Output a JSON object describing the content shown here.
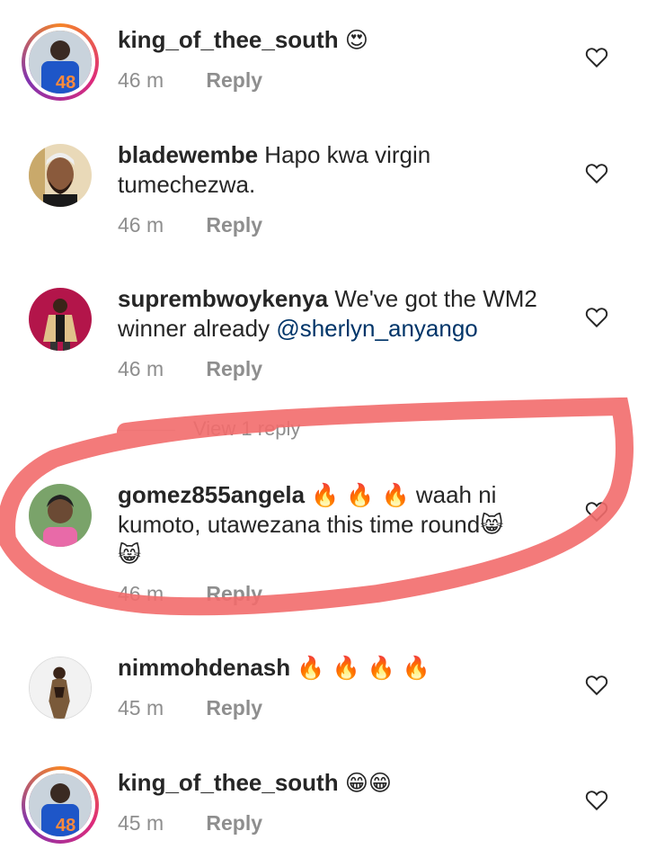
{
  "comments": [
    {
      "username": "king_of_thee_south",
      "text": "",
      "emoji": "😍",
      "time": "46 m",
      "reply": "Reply",
      "avatar": "jersey-48"
    },
    {
      "username": "bladewembe",
      "text": " Hapo kwa virgin",
      "text2": "tumechezwa.",
      "time": "46 m",
      "reply": "Reply",
      "avatar": "man-headwrap"
    },
    {
      "username": "suprembwoykenya",
      "text": " We've got the WM2",
      "text2": "winner already ",
      "mention": "@sherlyn_anyango",
      "time": "46 m",
      "reply": "Reply",
      "avatar": "man-suit"
    },
    {
      "username": "gomez855angela",
      "emoji_lead": "🔥 🔥 🔥",
      "text": " waah ni",
      "text2": "kumoto, utawezana this time round",
      "emoji_tail": "😸",
      "emoji_line3": "😸",
      "time": "46 m",
      "reply": "Reply",
      "avatar": "woman"
    },
    {
      "username": "nimmohdenash",
      "emoji": "🔥 🔥 🔥 🔥",
      "time": "45 m",
      "reply": "Reply",
      "avatar": "woman-dress"
    },
    {
      "username": "king_of_thee_south",
      "emoji": "😁😁",
      "time": "45 m",
      "reply": "Reply",
      "avatar": "jersey-48"
    }
  ],
  "view_replies": "View 1 reply",
  "jersey_number": "48",
  "colors": {
    "username": "#262626",
    "meta": "#8e8e8e",
    "mention": "#003569",
    "highlight": "#f26b6b"
  }
}
